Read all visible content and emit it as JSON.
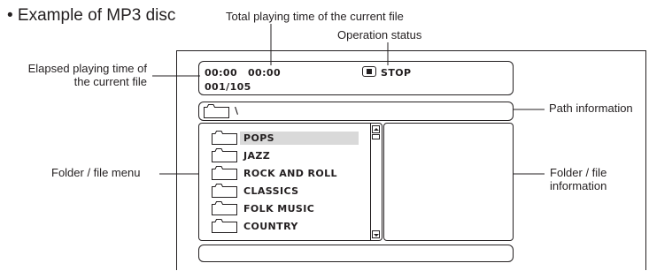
{
  "title": "• Example of MP3 disc",
  "callouts": {
    "total_time": "Total playing time of the current file",
    "operation_status": "Operation status",
    "elapsed_line1": "Elapsed playing time of",
    "elapsed_line2": "the current file",
    "path_info": "Path information",
    "folder_menu": "Folder / file menu",
    "folder_info_line1": "Folder / file",
    "folder_info_line2": "information"
  },
  "screen": {
    "elapsed": "00:00",
    "total": "00:00",
    "status": "STOP",
    "track_counter": "001/105",
    "path": "\\",
    "items": [
      "POPS",
      "JAZZ",
      "ROCK AND ROLL",
      "CLASSICS",
      "FOLK MUSIC",
      "COUNTRY"
    ],
    "selected_index": 0
  }
}
